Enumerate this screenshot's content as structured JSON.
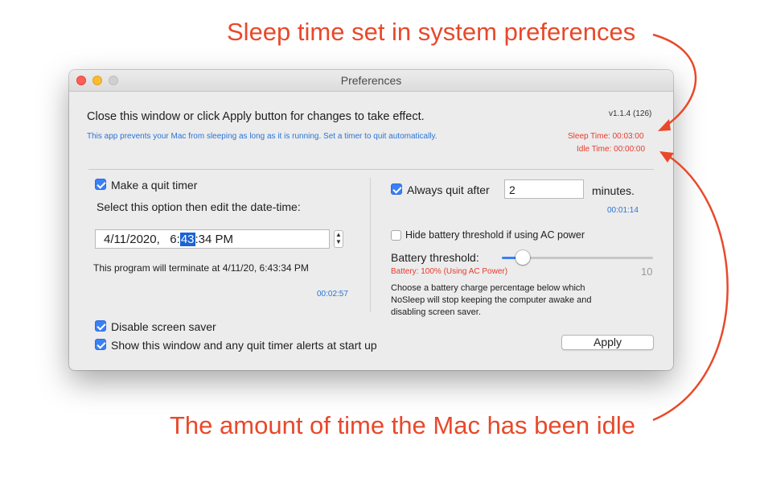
{
  "annotations": {
    "top": "Sleep time set in system preferences",
    "bottom": "The amount of time the Mac has been idle"
  },
  "window": {
    "title": "Preferences",
    "header_text": "Close this window or click Apply button for changes to take effect.",
    "version": "v1.1.4 (126)",
    "description": "This app prevents your Mac from sleeping as long as it is running. Set a timer to quit automatically.",
    "sleep_time": "Sleep Time: 00:03:00",
    "idle_time": "Idle Time: 00:00:00"
  },
  "left": {
    "quit_timer_label": "Make a quit timer",
    "quit_timer_checked": true,
    "select_option_text": "Select this option then edit the date-time:",
    "date_before": "4/11/2020,   6:",
    "date_selected": "43",
    "date_after": ":34 PM",
    "terminate_text": "This program will terminate at 4/11/20, 6:43:34 PM",
    "countdown": "00:02:57"
  },
  "right": {
    "always_quit_label": "Always quit after",
    "always_quit_checked": true,
    "minutes_value": "2",
    "minutes_label": "minutes.",
    "always_quit_countdown": "00:01:14",
    "hide_battery_label": "Hide battery threshold if using AC power",
    "hide_battery_checked": false,
    "battery_threshold_label": "Battery threshold:",
    "battery_status": "Battery: 100% (Using AC Power)",
    "slider_value": "10",
    "battery_help": [
      "Choose a battery charge percentage below which",
      "NoSleep will stop keeping the computer awake and",
      "disabling screen saver."
    ]
  },
  "bottom": {
    "disable_screensaver_label": "Disable screen saver",
    "disable_screensaver_checked": true,
    "show_window_label": "Show this window and any quit timer alerts at start up",
    "show_window_checked": true,
    "apply_label": "Apply"
  },
  "colors": {
    "annotation": "#e8492a",
    "accent_blue": "#3a80f6",
    "status_red": "#e63b2e",
    "info_blue": "#2a74d5"
  }
}
